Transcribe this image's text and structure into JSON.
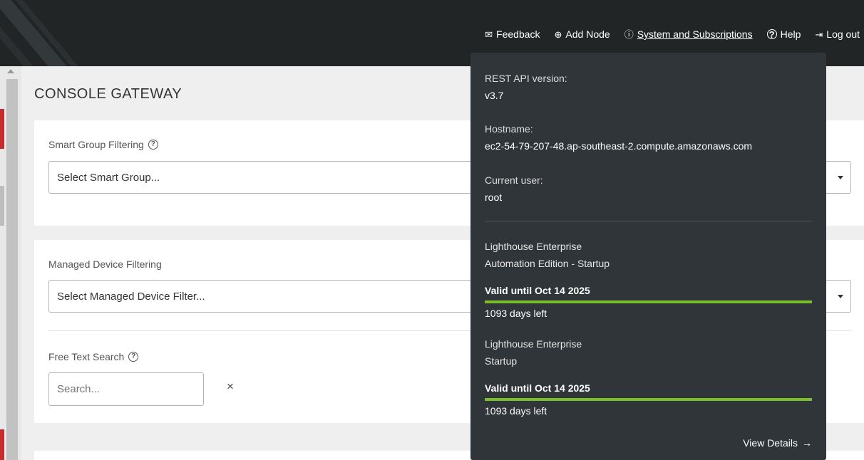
{
  "nav": {
    "feedback": {
      "icon": "envelope-icon",
      "glyph": "✉",
      "label": "Feedback"
    },
    "add_node": {
      "icon": "plus-circle-icon",
      "glyph": "⊕",
      "label": "Add Node"
    },
    "system": {
      "icon": "info-circle-icon",
      "glyph": "ⓘ",
      "label": "System and Subscriptions"
    },
    "help": {
      "icon": "question-circle-icon",
      "glyph": "?",
      "label": "Help"
    },
    "logout": {
      "icon": "logout-icon",
      "glyph": "⇥",
      "label": "Log out"
    }
  },
  "page": {
    "title": "CONSOLE GATEWAY"
  },
  "smart_group": {
    "label": "Smart Group Filtering",
    "help_glyph": "?",
    "selected": "Select Smart Group..."
  },
  "managed_device": {
    "label": "Managed Device Filtering",
    "selected": "Select Managed Device Filter..."
  },
  "free_text": {
    "label": "Free Text Search",
    "help_glyph": "?",
    "placeholder": "Search...",
    "clear_glyph": "×"
  },
  "popover": {
    "api_label": "REST API version:",
    "api_value": "v3.7",
    "hostname_label": "Hostname:",
    "hostname_value": "ec2-54-79-207-48.ap-southeast-2.compute.amazonaws.com",
    "user_label": "Current user:",
    "user_value": "root",
    "subscriptions": [
      {
        "line1": "Lighthouse Enterprise",
        "line2": "Automation Edition - Startup",
        "valid": "Valid until Oct 14 2025",
        "days": "1093 days left",
        "progress": 1.0
      },
      {
        "line1": "Lighthouse Enterprise",
        "line2": "Startup",
        "valid": "Valid until Oct 14 2025",
        "days": "1093 days left",
        "progress": 1.0
      }
    ],
    "view_details": "View Details",
    "view_details_arrow": "→"
  },
  "colors": {
    "topbar": "#222526",
    "popover": "#2f3538",
    "progress": "#7bbf2a",
    "accent_red": "#c72b2b"
  }
}
